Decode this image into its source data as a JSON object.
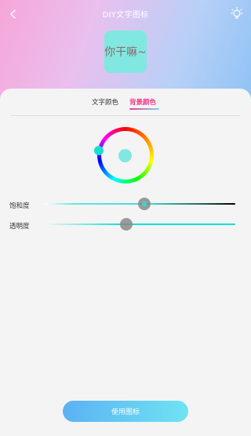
{
  "header": {
    "title": "DIY文字图标",
    "back_icon": "chevron-left-icon",
    "bulb_icon": "lightbulb-icon"
  },
  "preview": {
    "text": "你干嘛~",
    "background_color": "#80e8e0",
    "text_color": "#8e6a6a"
  },
  "tabs": [
    {
      "label": "文字颜色",
      "active": false
    },
    {
      "label": "背景颜色",
      "active": true
    }
  ],
  "color_picker": {
    "selected_color": "#80e8e0",
    "accent_color": "#14e0d0"
  },
  "sliders": {
    "saturation": {
      "label": "饱和度",
      "value_fraction": 0.52
    },
    "opacity": {
      "label": "透明度",
      "value_fraction": 0.43
    }
  },
  "footer": {
    "use_button_label": "使用图标"
  },
  "colors": {
    "active_tab": "#ee3d86",
    "button_gradient_start": "#5bb2f3",
    "button_gradient_end": "#6fe3f2"
  }
}
